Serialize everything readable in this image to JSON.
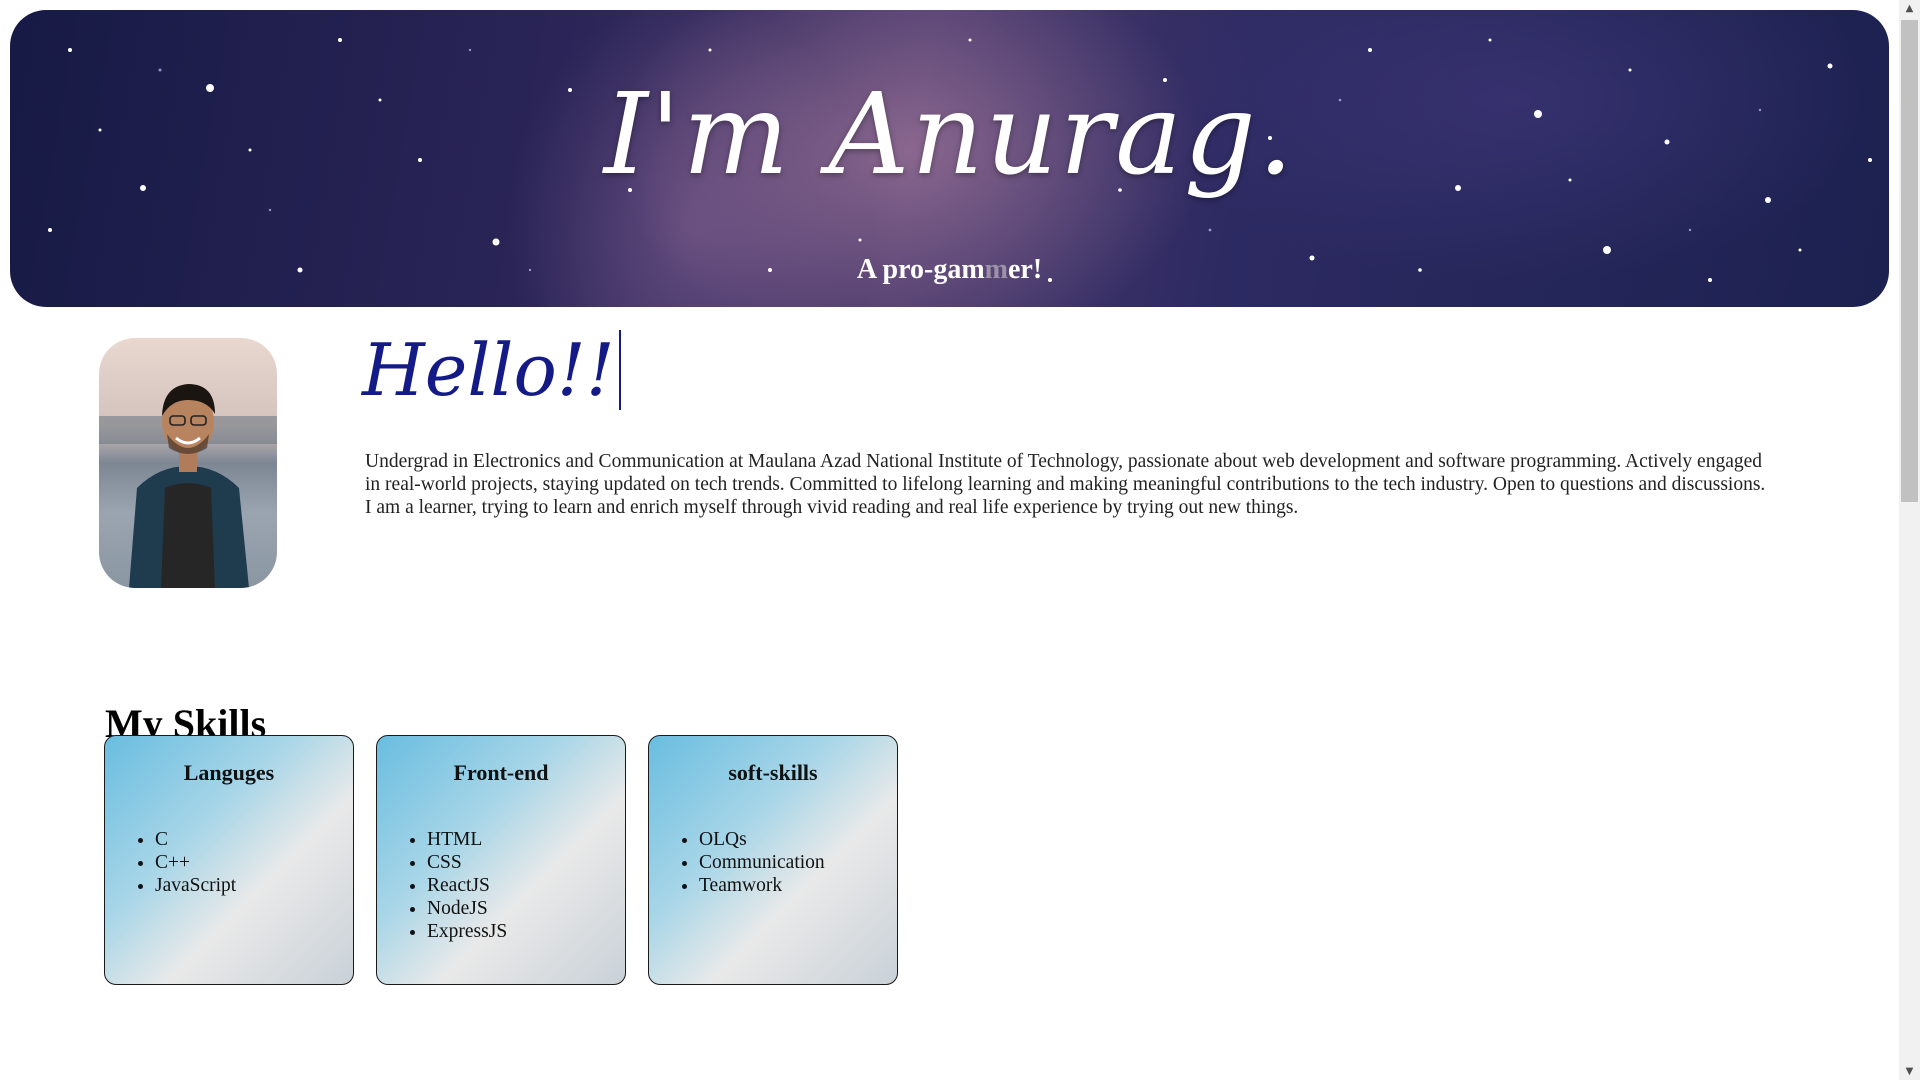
{
  "banner": {
    "title": "I'm Anurag.",
    "subtitle_a": "A pro-gam",
    "subtitle_b": "m",
    "subtitle_c": "er!"
  },
  "intro": {
    "greeting": "Hello!!",
    "bio": "Undergrad in Electronics and Communication at Maulana Azad National Institute of Technology, passionate about web development and software programming. Actively engaged in real-world projects, staying updated on tech trends. Committed to lifelong learning and making meaningful contributions to the tech industry. Open to questions and discussions. I am a learner, trying to learn and enrich myself through vivid reading and real life experience by trying out new things."
  },
  "skills": {
    "title": "My Skills",
    "cards": [
      {
        "heading": "Languges",
        "items": [
          "C",
          "C++",
          "JavaScript"
        ]
      },
      {
        "heading": "Front-end",
        "items": [
          "HTML",
          "CSS",
          "ReactJS",
          "NodeJS",
          "ExpressJS"
        ]
      },
      {
        "heading": "soft-skills",
        "items": [
          "OLQs",
          "Communication",
          "Teamwork"
        ]
      }
    ]
  },
  "scrollbar": {
    "up_icon": "triangle-up",
    "down_icon": "triangle-down"
  },
  "colors": {
    "accent": "#141a86",
    "banner_bg": "#2b2558",
    "card_gradient_start": "#69bde0"
  }
}
